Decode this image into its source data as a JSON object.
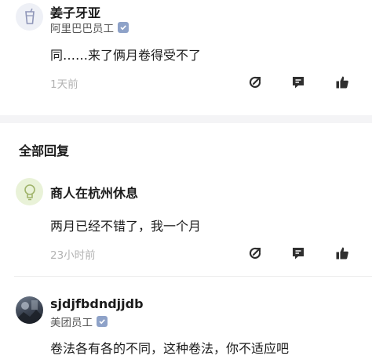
{
  "top_comment": {
    "author": "姜子牙亚",
    "company": "阿里巴巴员工",
    "text": "同……来了俩月卷得受不了",
    "time": "1天前"
  },
  "section": {
    "title": "全部回复"
  },
  "replies": [
    {
      "author": "商人在杭州休息",
      "text": "两月已经不错了，我一个月",
      "time": "23小时前"
    },
    {
      "author": "sjdjfbdndjjdb",
      "company": "美团员工",
      "text": "卷法各有各的不同，这种卷法，你不适应吧"
    }
  ],
  "icons": {
    "action_1": "share-icon",
    "action_2": "comment-icon",
    "action_3": "like-icon",
    "verified": "verified-badge-icon"
  },
  "colors": {
    "icon": "#2f2f2f",
    "verified": "#8ea2c8",
    "muted": "#b3b3b3",
    "divider": "#f4f4f6"
  }
}
